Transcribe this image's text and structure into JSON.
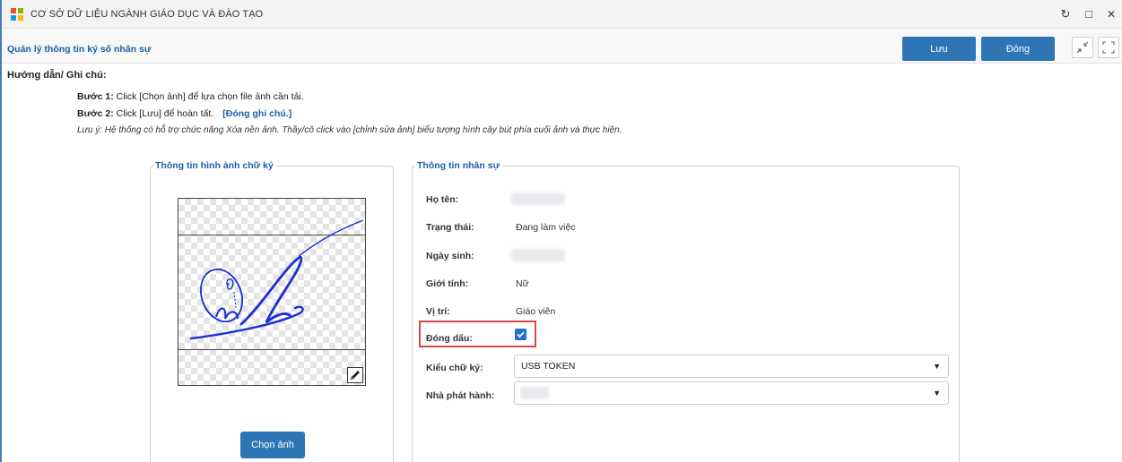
{
  "window": {
    "title": "CƠ SỞ DỮ LIỆU NGÀNH GIÁO DỤC VÀ ĐÀO TẠO",
    "controls": {
      "refresh": "↻",
      "maximize": "□",
      "close": "✕"
    }
  },
  "header": {
    "page_title": "Quản lý thông tin ký số nhân sự",
    "save_label": "Lưu",
    "close_label": "Đóng"
  },
  "guide": {
    "title": "Hướng dẫn/ Ghi chú:",
    "step1_prefix": "Bước 1:",
    "step1_text": " Click [Chọn ảnh] để lựa chọn file ảnh cần tải.",
    "step2_prefix": "Bước 2:",
    "step2_text": " Click [Lưu] để hoàn tất.",
    "toggle_note": "[Đóng ghi chú.]",
    "note": "Lưu ý: Hệ thống có hỗ trợ chức năng Xóa nền ảnh. Thầy/cô click vào [chỉnh sửa ảnh] biểu tượng hình cây bút phía cuối ảnh và thực hiện."
  },
  "signature_panel": {
    "legend": "Thông tin hình ảnh chữ ký",
    "choose_label": "Chọn ảnh"
  },
  "staff_panel": {
    "legend": "Thông tin nhân sự",
    "name_label": "Họ tên:",
    "status_label": "Trạng thái:",
    "status_value": "Đang làm việc",
    "dob_label": "Ngày sinh:",
    "gender_label": "Giới tính:",
    "gender_value": "Nữ",
    "position_label": "Vị trí:",
    "position_value": "Giáo viên",
    "stamp_label": "Đóng dấu:",
    "stamp_checked": true,
    "sign_type_label": "Kiểu chữ ký:",
    "sign_type_value": "USB TOKEN",
    "issuer_label": "Nhà phát hành:",
    "issuer_value": ""
  },
  "colors": {
    "accent": "#2e75b6",
    "link": "#1a5fa8",
    "highlight": "#d9464b",
    "checkbox": "#1f6fd2"
  }
}
